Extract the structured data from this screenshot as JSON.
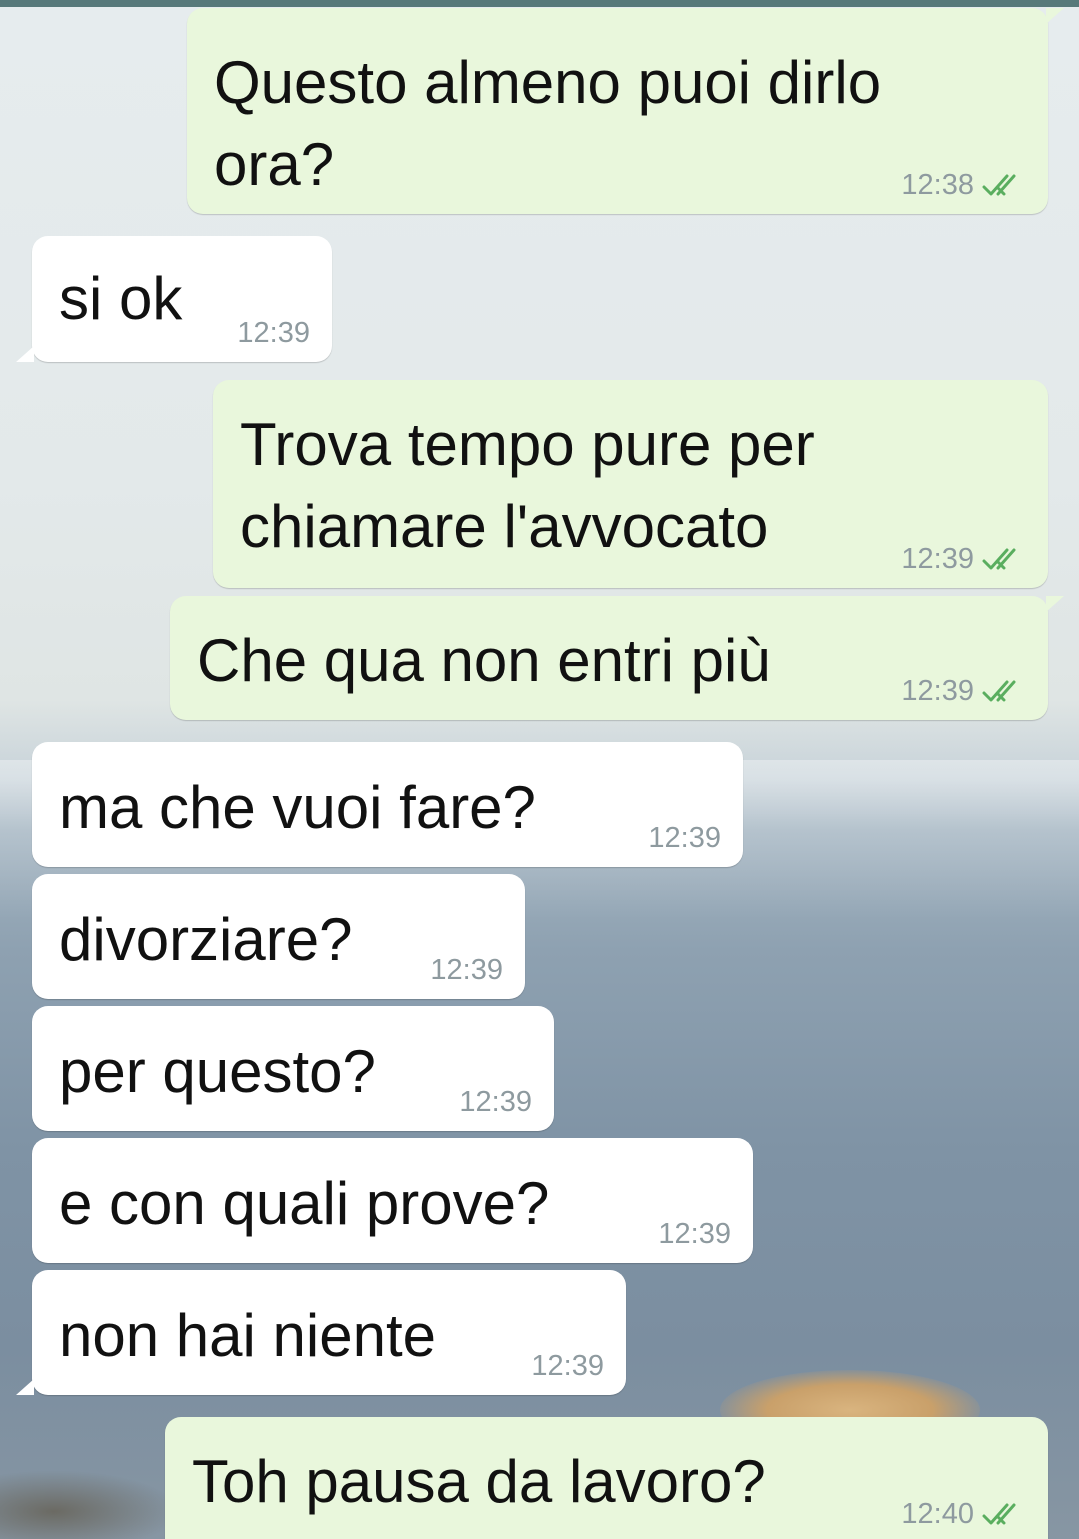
{
  "messages": [
    {
      "direction": "out",
      "text": "Questo almeno puoi dirlo\nora?",
      "time": "12:38",
      "status": "read",
      "tail": true
    },
    {
      "direction": "in",
      "text": "si ok",
      "time": "12:39",
      "tail": true
    },
    {
      "direction": "out",
      "text": "Trova tempo pure per\nchiamare l'avvocato",
      "time": "12:39",
      "status": "read",
      "tail": false
    },
    {
      "direction": "out",
      "text": "Che qua non entri più",
      "time": "12:39",
      "status": "read",
      "tail": true
    },
    {
      "direction": "in",
      "text": "ma che vuoi fare?",
      "time": "12:39",
      "tail": false
    },
    {
      "direction": "in",
      "text": "divorziare?",
      "time": "12:39",
      "tail": false
    },
    {
      "direction": "in",
      "text": "per questo?",
      "time": "12:39",
      "tail": false
    },
    {
      "direction": "in",
      "text": "e con quali prove?",
      "time": "12:39",
      "tail": false
    },
    {
      "direction": "in",
      "text": "non hai niente",
      "time": "12:39",
      "tail": true
    },
    {
      "direction": "out",
      "text": "Toh pausa da lavoro?",
      "time": "12:40",
      "status": "read",
      "tail": false
    }
  ],
  "icons": {
    "read_status": "double-check-icon"
  },
  "colors": {
    "outgoing_bubble": "#e9f7dc",
    "incoming_bubble": "#ffffff",
    "read_ticks": "#5aae5f",
    "timestamp": "#8e9a9f",
    "top_bar": "#57797a"
  }
}
